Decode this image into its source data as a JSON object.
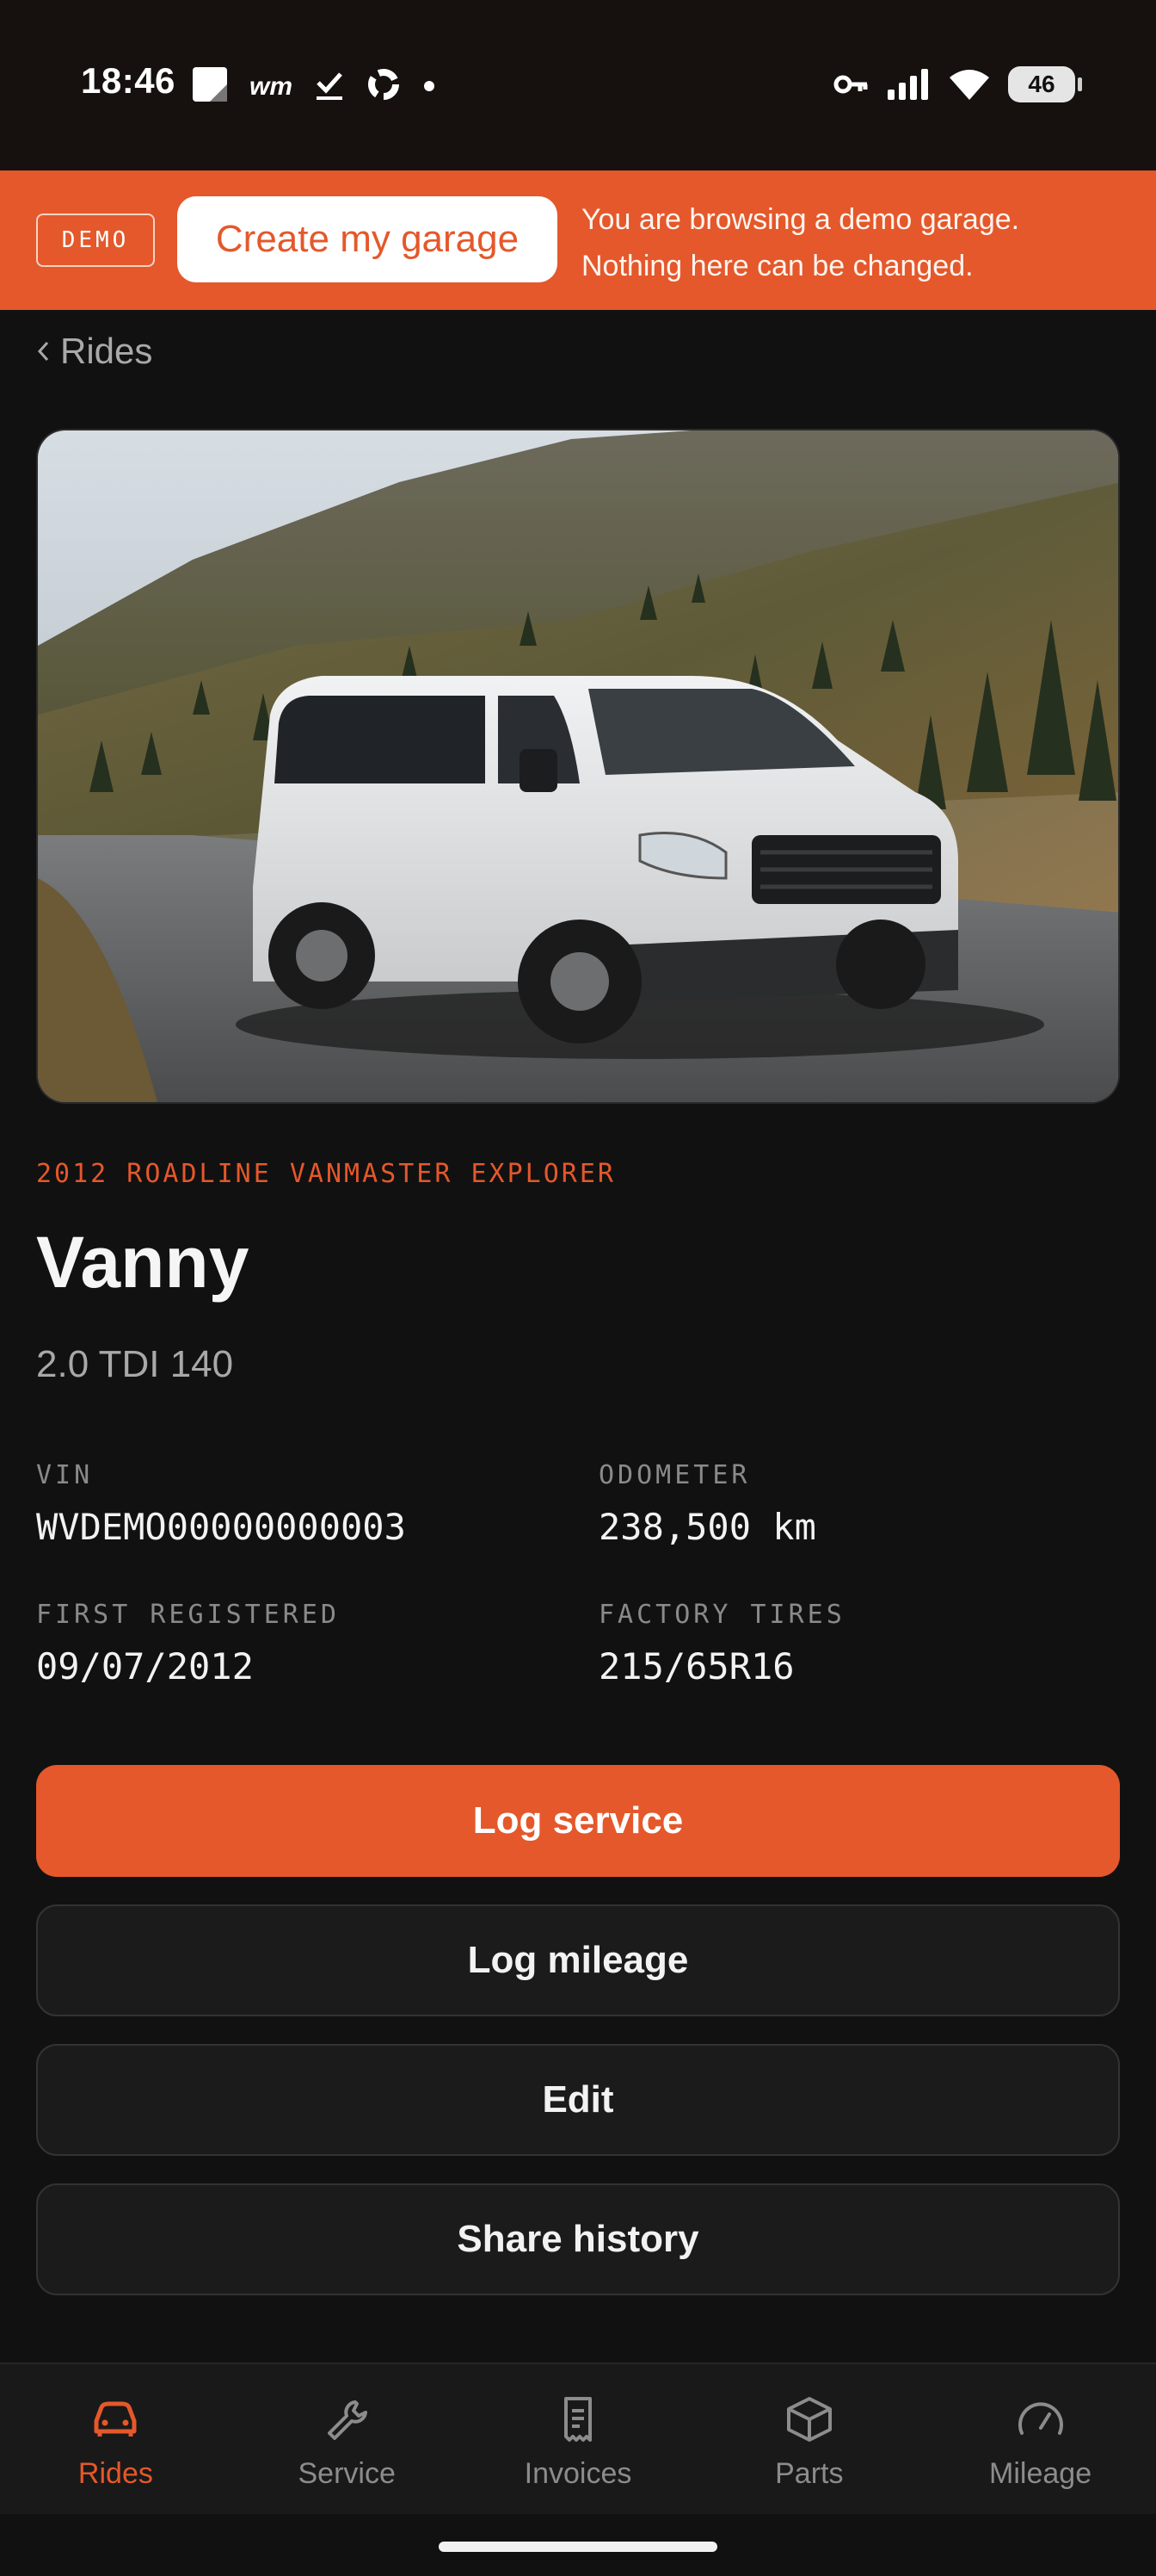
{
  "status_bar": {
    "time": "18:46",
    "battery": "46",
    "left_icons": [
      "notes-icon",
      "wm-icon",
      "check-icon",
      "sync-icon",
      "dot-icon"
    ],
    "right_icons": [
      "key-icon",
      "signal-icon",
      "wifi-icon",
      "battery-icon"
    ]
  },
  "demo_banner": {
    "tag": "DEMO",
    "cta": "Create my garage",
    "message_line1": "You are browsing a demo garage.",
    "message_line2": "Nothing here can be changed.",
    "color": "#e4582b"
  },
  "nav": {
    "back_label": "Rides"
  },
  "vehicle": {
    "make_model": "2012 ROADLINE VANMASTER EXPLORER",
    "name": "Vanny",
    "engine": "2.0 TDI 140",
    "specs": [
      {
        "label": "VIN",
        "value": "WVDEMO00000000003"
      },
      {
        "label": "ODOMETER",
        "value": "238,500 km"
      },
      {
        "label": "FIRST REGISTERED",
        "value": "09/07/2012"
      },
      {
        "label": "FACTORY TIRES",
        "value": "215/65R16"
      }
    ]
  },
  "actions": {
    "log_service": "Log service",
    "log_mileage": "Log mileage",
    "edit": "Edit",
    "share_history": "Share history"
  },
  "tabs": [
    {
      "label": "Rides",
      "icon": "car-icon",
      "active": true
    },
    {
      "label": "Service",
      "icon": "wrench-icon",
      "active": false
    },
    {
      "label": "Invoices",
      "icon": "receipt-icon",
      "active": false
    },
    {
      "label": "Parts",
      "icon": "box-icon",
      "active": false
    },
    {
      "label": "Mileage",
      "icon": "gauge-icon",
      "active": false
    }
  ],
  "theme": {
    "accent": "#e4582b",
    "background": "#111111",
    "surface": "#1b1b1b"
  }
}
